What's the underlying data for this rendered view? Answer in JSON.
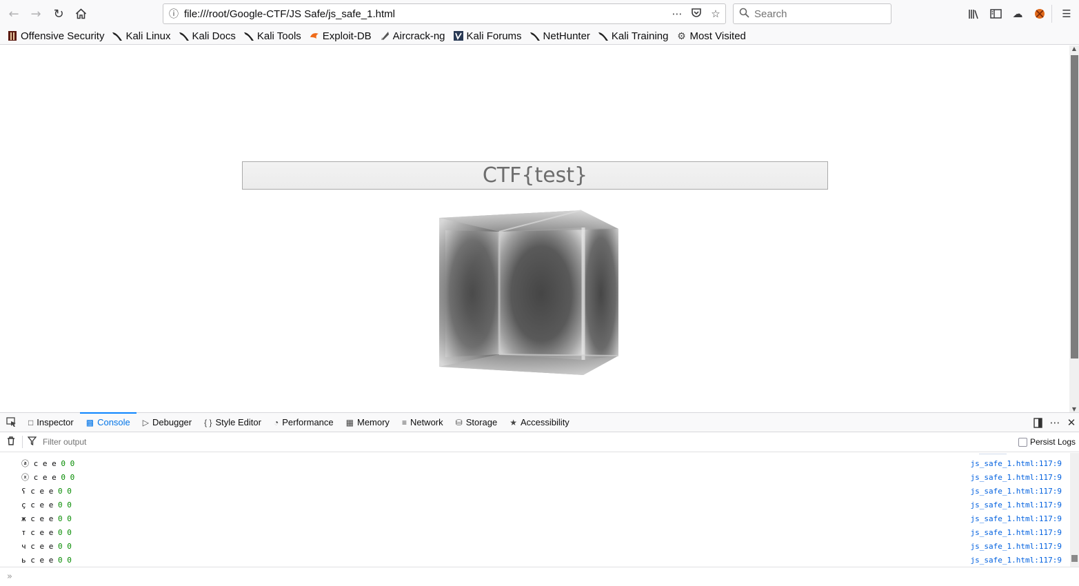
{
  "browser": {
    "url": "file:///root/Google-CTF/JS Safe/js_safe_1.html",
    "search_placeholder": "Search",
    "icons": [
      "back-arrow",
      "forward-arrow",
      "reload",
      "home",
      "info",
      "page-actions",
      "pocket",
      "star",
      "library",
      "sidebar",
      "sync",
      "addon",
      "hamburger-menu"
    ]
  },
  "bookmarks": [
    {
      "label": "Offensive Security",
      "icon": "offsec-icon"
    },
    {
      "label": "Kali Linux",
      "icon": "kali-dragon-icon"
    },
    {
      "label": "Kali Docs",
      "icon": "kali-dragon-icon"
    },
    {
      "label": "Kali Tools",
      "icon": "kali-dragon-icon"
    },
    {
      "label": "Exploit-DB",
      "icon": "exploitdb-icon"
    },
    {
      "label": "Aircrack-ng",
      "icon": "aircrack-icon"
    },
    {
      "label": "Kali Forums",
      "icon": "kali-forums-icon"
    },
    {
      "label": "NetHunter",
      "icon": "kali-dragon-icon"
    },
    {
      "label": "Kali Training",
      "icon": "kali-dragon-icon"
    },
    {
      "label": "Most Visited",
      "icon": "gear-icon"
    }
  ],
  "page": {
    "flag_input_value": "CTF{test}"
  },
  "devtools": {
    "tabs": [
      {
        "label": "Inspector",
        "icon": "inspector-icon"
      },
      {
        "label": "Console",
        "icon": "console-icon",
        "selected": true
      },
      {
        "label": "Debugger",
        "icon": "debugger-icon"
      },
      {
        "label": "Style Editor",
        "icon": "braces-icon"
      },
      {
        "label": "Performance",
        "icon": "performance-icon"
      },
      {
        "label": "Memory",
        "icon": "memory-icon"
      },
      {
        "label": "Network",
        "icon": "network-icon"
      },
      {
        "label": "Storage",
        "icon": "storage-icon"
      },
      {
        "label": "Accessibility",
        "icon": "accessibility-icon"
      }
    ],
    "filter_placeholder": "Filter output",
    "persist_logs_label": "Persist Logs",
    "persist_logs_checked": false,
    "console_rows": [
      {
        "glyph": "ⓐ",
        "text": "c e e",
        "nums": "0 0",
        "source": "js_safe_1.html:117:9"
      },
      {
        "glyph": "ⓧ",
        "text": "c e e",
        "nums": "0 0",
        "source": "js_safe_1.html:117:9"
      },
      {
        "glyph": "ʕ",
        "text": "c e e",
        "nums": "0 0",
        "source": "js_safe_1.html:117:9"
      },
      {
        "glyph": "ç",
        "text": "c e e",
        "nums": "0 0",
        "source": "js_safe_1.html:117:9"
      },
      {
        "glyph": "ж",
        "text": "c e e",
        "nums": "0 0",
        "source": "js_safe_1.html:117:9"
      },
      {
        "glyph": "т",
        "text": "c e e",
        "nums": "0 0",
        "source": "js_safe_1.html:117:9"
      },
      {
        "glyph": "ч",
        "text": "c e e",
        "nums": "0 0",
        "source": "js_safe_1.html:117:9"
      },
      {
        "glyph": "ь",
        "text": "c e e",
        "nums": "0 0",
        "source": "js_safe_1.html:117:9"
      }
    ]
  }
}
